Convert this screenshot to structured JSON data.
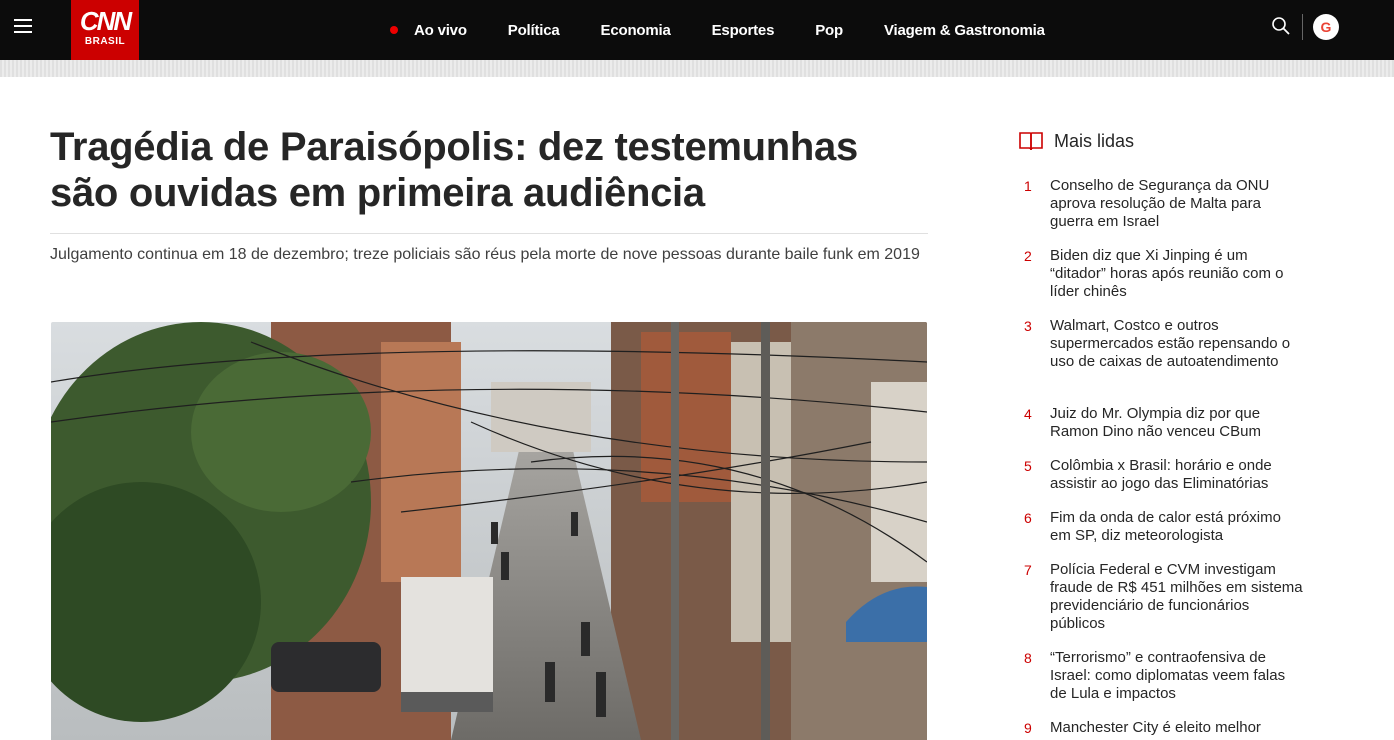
{
  "header": {
    "logo_main": "CNN",
    "logo_sub": "BRASIL",
    "nav": [
      {
        "label": "Ao vivo",
        "live": true
      },
      {
        "label": "Política"
      },
      {
        "label": "Economia"
      },
      {
        "label": "Esportes"
      },
      {
        "label": "Pop"
      },
      {
        "label": "Viagem & Gastronomia"
      }
    ],
    "account_icon_letter": "G"
  },
  "article": {
    "headline": "Tragédia de Paraisópolis: dez testemunhas são ouvidas em primeira audiência",
    "subtitle": "Julgamento continua em 18 de dezembro; treze policiais são réus pela morte de nove pessoas durante baile funk em 2019"
  },
  "sidebar": {
    "title": "Mais lidas",
    "items": [
      {
        "num": "1",
        "text": "Conselho de Segurança da ONU aprova resolução de Malta para guerra em Israel"
      },
      {
        "num": "2",
        "text": "Biden diz que Xi Jinping é um “ditador” horas após reunião com o líder chinês"
      },
      {
        "num": "3",
        "text": "Walmart, Costco e outros supermercados estão repensando o uso de caixas de autoatendimento"
      },
      {
        "num": "4",
        "text": "Juiz do Mr. Olympia diz por que Ramon Dino não venceu CBum"
      },
      {
        "num": "5",
        "text": "Colômbia x Brasil: horário e onde assistir ao jogo das Eliminatórias"
      },
      {
        "num": "6",
        "text": "Fim da onda de calor está próximo em SP, diz meteorologista"
      },
      {
        "num": "7",
        "text": "Polícia Federal e CVM investigam fraude de R$ 451 milhões em sistema previdenciário de funcionários públicos"
      },
      {
        "num": "8",
        "text": "“Terrorismo” e contraofensiva de Israel: como diplomatas veem falas de Lula e impactos"
      },
      {
        "num": "9",
        "text": "Manchester City é eleito melhor"
      }
    ]
  },
  "colors": {
    "brand": "#cc0000",
    "header_bg": "#0c0c0c"
  }
}
